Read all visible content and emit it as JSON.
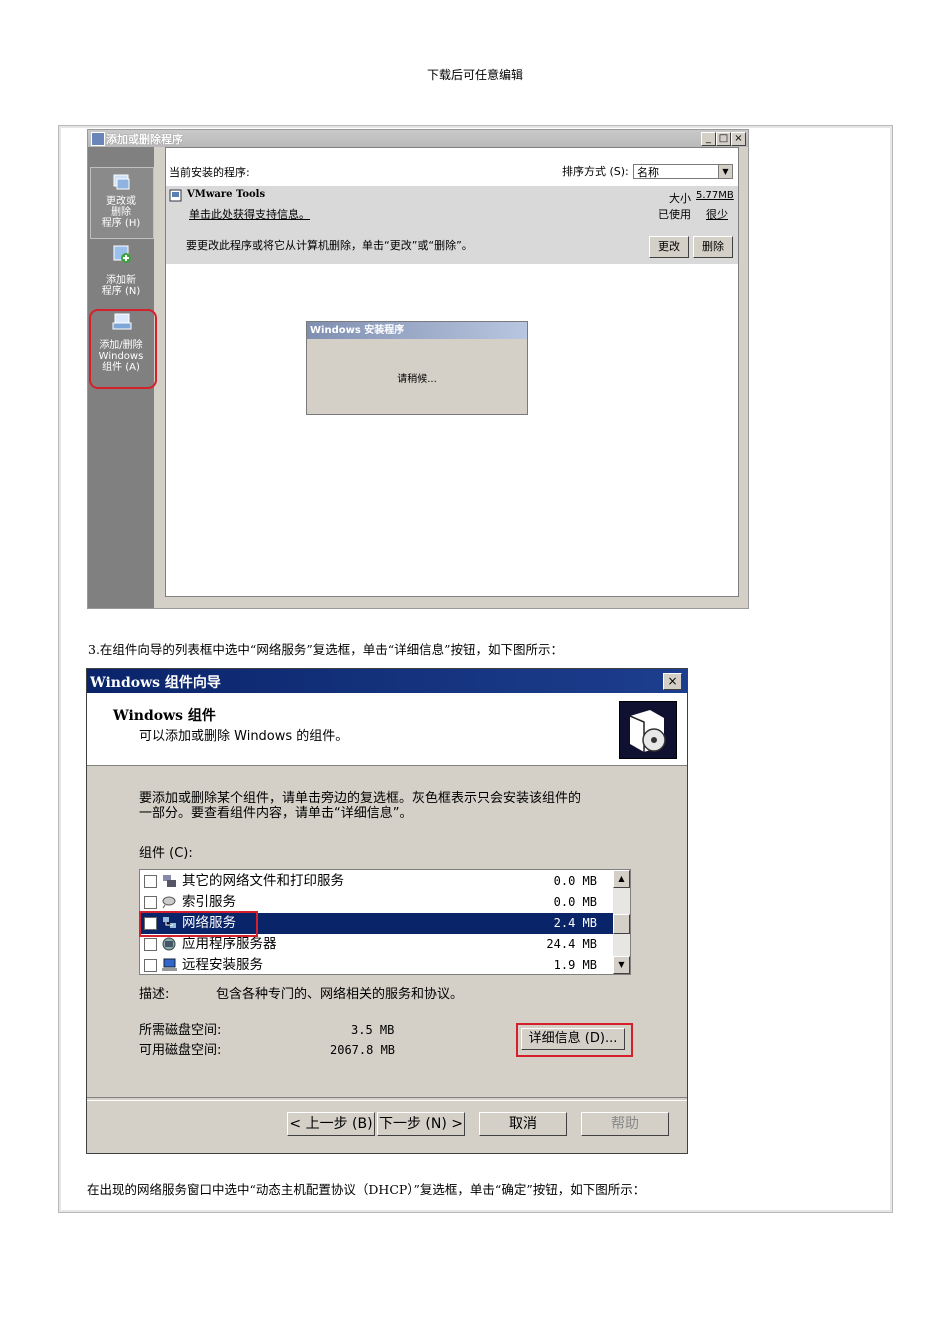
{
  "header_note": "下载后可任意编辑",
  "screenshot1": {
    "window_title": "添加或删除程序",
    "title_buttons": [
      "_",
      "□",
      "×"
    ],
    "sidebar": [
      {
        "label_lines": [
          "更改或",
          "删除",
          "程序 (H)"
        ]
      },
      {
        "label_lines": [
          "添加新",
          "程序 (N)"
        ]
      },
      {
        "label_lines": [
          "添加/删除",
          "Windows",
          "组件 (A)"
        ]
      }
    ],
    "current_programs_label": "当前安装的程序:",
    "sort_label": "排序方式 (S):",
    "sort_value": "名称",
    "program": {
      "name": "VMware Tools",
      "support_link": "单击此处获得支持信息。",
      "size_label": "大小",
      "size_value": "5.77MB",
      "used_label": "已使用",
      "used_value": "很少",
      "instruction": "要更改此程序或将它从计算机删除，单击“更改”或“删除”。",
      "change_button": "更改",
      "remove_button": "删除"
    },
    "setup_dialog": {
      "title": "Windows 安装程序",
      "message": "请稍候..."
    }
  },
  "step3_text": "3.在组件向导的列表框中选中“网络服务”复选框，单击“详细信息”按钮，如下图所示：",
  "screenshot2": {
    "window_title": "Windows 组件向导",
    "close": "×",
    "heading": "Windows 组件",
    "subheading": "可以添加或删除 Windows 的组件。",
    "instruction_line1": "要添加或删除某个组件，请单击旁边的复选框。灰色框表示只会安装该组件的",
    "instruction_line2": "一部分。要查看组件内容，请单击“详细信息”。",
    "components_label": "组件 (C):",
    "components": [
      {
        "name": "其它的网络文件和打印服务",
        "size": "0.0 MB",
        "checked": false
      },
      {
        "name": "索引服务",
        "size": "0.0 MB",
        "checked": false
      },
      {
        "name": "网络服务",
        "size": "2.4 MB",
        "checked": true
      },
      {
        "name": "应用程序服务器",
        "size": "24.4 MB",
        "checked": false
      },
      {
        "name": "远程安装服务",
        "size": "1.9 MB",
        "checked": false
      }
    ],
    "description_label": "描述:",
    "description": "包含各种专门的、网络相关的服务和协议。",
    "required_space_label": "所需磁盘空间:",
    "required_space": "3.5 MB",
    "available_space_label": "可用磁盘空间:",
    "available_space": "2067.8 MB",
    "details_button": "详细信息 (D)...",
    "back_button": "< 上一步 (B)",
    "next_button": "下一步 (N) >",
    "cancel_button": "取消",
    "help_button": "帮助"
  },
  "closing_text": "在出现的网络服务窗口中选中“动态主机配置协议（DHCP）”复选框，单击“确定”按钮，如下图所示："
}
